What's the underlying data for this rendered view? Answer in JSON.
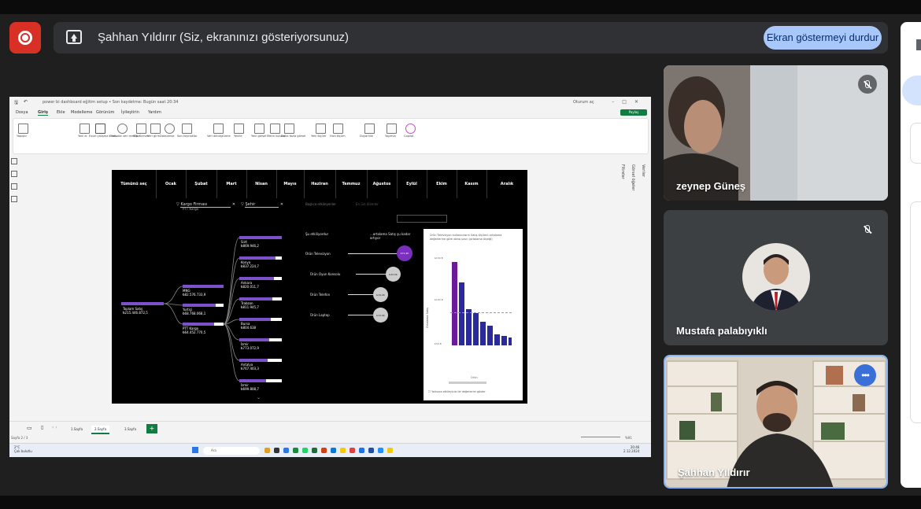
{
  "meet": {
    "presenting_text": "Şahhan Yıldırır (Siz, ekranınızı gösteriyorsunuz)",
    "stop_button": "Ekran göstermeyi durdur"
  },
  "screen": {
    "window_title": "power bi dashboard eğitim setup • Son kaydetme: Bugün saat 20:34",
    "search_placeholder": "Oturum aç",
    "share_button": "Paylaş",
    "menu": [
      "Dosya",
      "Giriş",
      "Ekle",
      "Modelleme",
      "Görünüm",
      "İyileştirin",
      "Yardım"
    ],
    "ribbon_items": [
      "Yapıştır",
      "Yeni al",
      "Excel çalışma kitabı",
      "OneLake veri merkezi",
      "SQL Server",
      "Veri girin",
      "Dataverse",
      "Son kaynaklar",
      "Veri dönüştürme",
      "Yenile",
      "Yeni görsel",
      "Metin kutusu",
      "Daha fazla görsel",
      "Yeni ölçüm",
      "Hızlı ölçüm",
      "Duyarlılık",
      "Yayımla",
      "Copilot"
    ],
    "side_panes": [
      "Veriler",
      "Görsel öğeler",
      "Filtreler"
    ],
    "months": [
      "Tümünü seç",
      "Ocak",
      "Şubat",
      "Mart",
      "Nisan",
      "Mayıs",
      "Haziran",
      "Temmuz",
      "Ağustos",
      "Eylül",
      "Ekim",
      "Kasım",
      "Aralık"
    ],
    "filters": {
      "cargo_label": "Kargo Firması",
      "cargo_value": "PTT Kargo",
      "city_label": "Şehir"
    },
    "tree": {
      "root": {
        "label": "Toplam Satış",
        "value": "₺215.446.872,5"
      },
      "level1": [
        {
          "label": "MNG",
          "value": "₺82.576.733,9"
        },
        {
          "label": "Yurtiçi",
          "value": "₺68.768.068,1"
        },
        {
          "label": "PTT Kargo",
          "value": "₺64.452.770,5"
        }
      ],
      "level2": [
        {
          "label": "Siirt",
          "value": "₺869.946,2"
        },
        {
          "label": "Konya",
          "value": "₺837.224,7"
        },
        {
          "label": "Ankara",
          "value": "₺820.011,7"
        },
        {
          "label": "Trabzon",
          "value": "₺811.945,7"
        },
        {
          "label": "Bursa",
          "value": "₺804.638"
        },
        {
          "label": "İzmir",
          "value": "₺773.072,9"
        },
        {
          "label": "Antalya",
          "value": "₺767.403,3"
        },
        {
          "label": "İzmir",
          "value": "₺699.808,7"
        }
      ]
    },
    "key_influencers": {
      "tabs": [
        "Başlıca etkileyenler",
        "En üst dilimler"
      ],
      "question_label": "Şu etkiliyordur",
      "answer_label": "...ortalama Satış şu kadar artıyor",
      "factors": [
        {
          "label": "Ürün Televizyon",
          "value": "₺71,4K"
        },
        {
          "label": "Ürün Oyun Konsolu",
          "value": "₺43,5K"
        },
        {
          "label": "Ürün Telefon",
          "value": "₺19,2K"
        },
        {
          "label": "Ürün Laptop",
          "value": "₺13,9K"
        }
      ],
      "detail_text": "Ürün Televizyon kullanıcıların Satış ölçümü ortalama değerlerine göre daha uzun (ortalama ölçeği)",
      "y_axis_label": "Ortalama Satış",
      "y_ticks": [
        "₺150 B",
        "₺100 B",
        "₺50 B"
      ],
      "x_axis_label": "Ürün",
      "checkbox_label": "Yalnızca etkileyicisi ile değerlerini göster"
    },
    "page_tabs": [
      "1.Sayfa",
      "2.Sayfa",
      "3.Sayfa"
    ],
    "status_left": "Sayfa 2 / 3",
    "zoom": "%91",
    "taskbar_search": "Ara",
    "weather": "2°C",
    "weather_desc": "Çok bulutlu",
    "clock": "20:46",
    "date": "2.12.2024"
  },
  "participants": [
    {
      "name": "zeynep Güneş",
      "muted": true
    },
    {
      "name": "Mustafa palabıyıklı",
      "muted": true
    },
    {
      "name": "Şahhan Yıldırır",
      "muted": false,
      "active_speaker": true
    }
  ],
  "colors": {
    "record": "#d93025",
    "stop_button_bg": "#a8c7fa",
    "active_border": "#8ab4f8",
    "powerbi_purple": "#7b52c9",
    "bar_purple": "#6a1b9a",
    "bar_navy": "#2a2a9a"
  }
}
